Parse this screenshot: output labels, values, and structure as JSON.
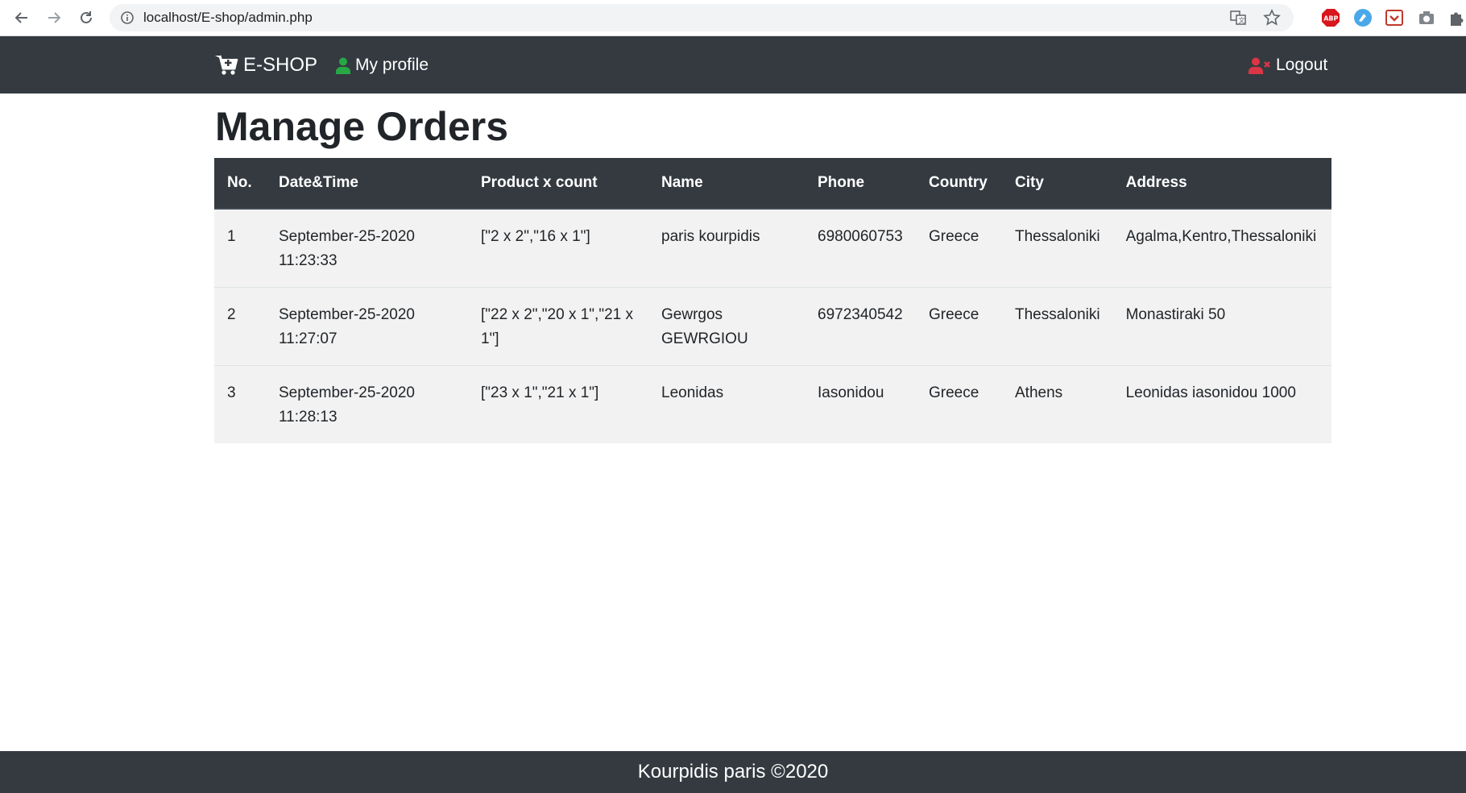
{
  "browser": {
    "url": "localhost/E-shop/admin.php"
  },
  "navbar": {
    "brand": "E-SHOP",
    "profile_label": "My profile",
    "logout_label": "Logout",
    "colors": {
      "background": "#343a40",
      "profile_icon": "#28a745",
      "logout_icon": "#dc3545"
    }
  },
  "page": {
    "title": "Manage Orders"
  },
  "table": {
    "headers": [
      "No.",
      "Date&Time",
      "Product x count",
      "Name",
      "Phone",
      "Country",
      "City",
      "Address"
    ],
    "rows": [
      {
        "no": "1",
        "datetime": "September-25-2020 11:23:33",
        "products": "[\"2 x 2\",\"16 x 1\"]",
        "name": "paris kourpidis",
        "phone": "6980060753",
        "country": "Greece",
        "city": "Thessaloniki",
        "address": "Agalma,Kentro,Thessaloniki"
      },
      {
        "no": "2",
        "datetime": "September-25-2020 11:27:07",
        "products": "[\"22 x 2\",\"20 x 1\",\"21 x 1\"]",
        "name": "Gewrgos GEWRGIOU",
        "phone": "6972340542",
        "country": "Greece",
        "city": "Thessaloniki",
        "address": "Monastiraki 50"
      },
      {
        "no": "3",
        "datetime": "September-25-2020 11:28:13",
        "products": "[\"23 x 1\",\"21 x 1\"]",
        "name": "Leonidas",
        "phone": "Iasonidou",
        "country": "Greece",
        "city": "Athens",
        "address": "Leonidas iasonidou 1000"
      }
    ]
  },
  "footer": {
    "text": "Kourpidis paris ©2020"
  }
}
